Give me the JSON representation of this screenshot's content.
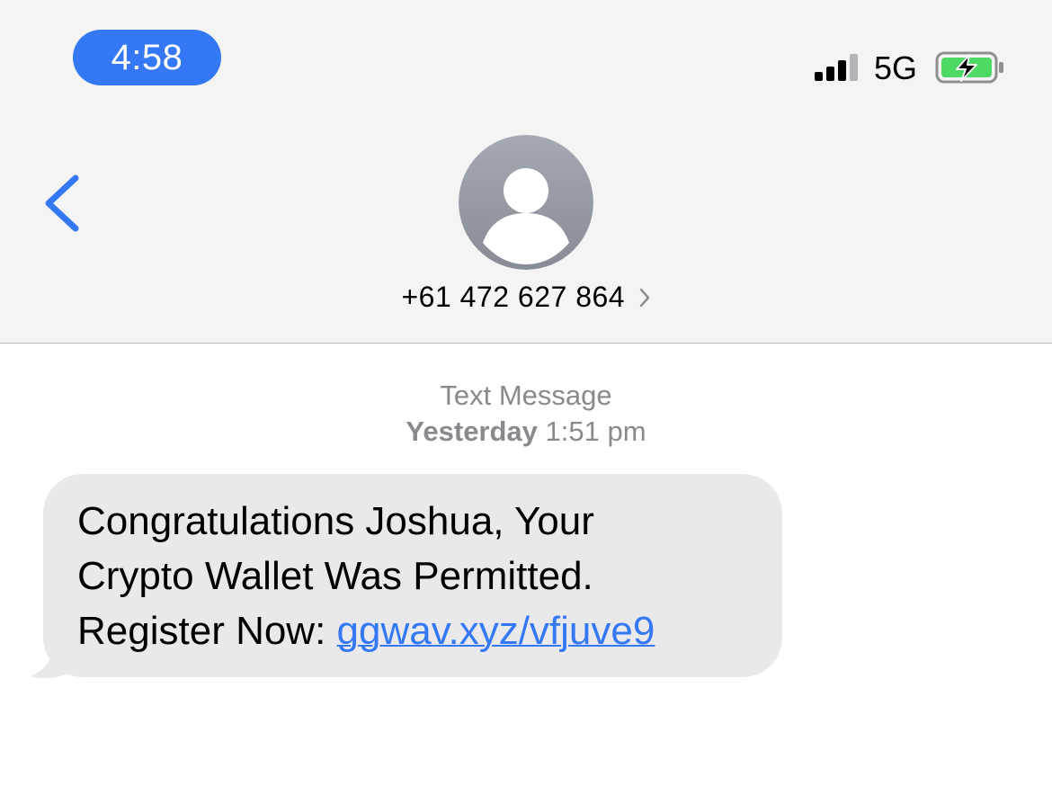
{
  "status_bar": {
    "time": "4:58",
    "network": "5G",
    "icons": [
      "signal-bars-icon",
      "battery-charging-icon"
    ]
  },
  "nav": {
    "back_icon": "chevron-left-icon",
    "avatar_icon": "person-silhouette-icon",
    "contact_number": "+61 472 627 864",
    "contact_chevron_icon": "chevron-right-icon"
  },
  "conversation": {
    "service_label": "Text Message",
    "date_day": "Yesterday",
    "date_time": "1:51 pm",
    "message": {
      "line1": "Congratulations Joshua, Your",
      "line2": "Crypto Wallet Was Permitted.",
      "line3_prefix": "Register Now: ",
      "link": "ggwav.xyz/vfjuve9"
    }
  },
  "colors": {
    "accent": "#3478f6",
    "header_bg": "#f4f4f4",
    "bubble_bg": "#e9e9eb",
    "meta_text": "#8a8a8e",
    "battery_fill": "#4cd964"
  }
}
